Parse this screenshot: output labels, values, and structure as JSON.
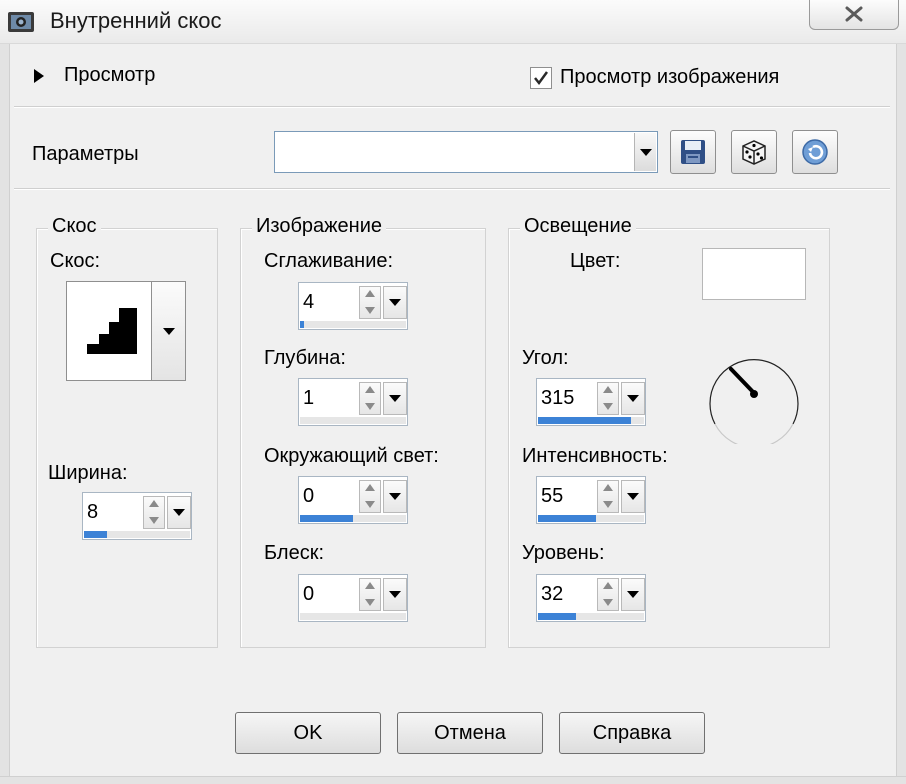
{
  "window": {
    "title": "Внутренний скос"
  },
  "preview": {
    "label": "Просмотр",
    "image_preview_label": "Просмотр изображения",
    "image_preview_checked": true
  },
  "params": {
    "label": "Параметры",
    "value": ""
  },
  "bevel_group": {
    "title": "Скос",
    "bevel_label": "Скос:",
    "width_label": "Ширина:",
    "width_value": "8",
    "width_level": 0.22
  },
  "image_group": {
    "title": "Изображение",
    "smoothing_label": "Сглаживание:",
    "smoothing_value": "4",
    "smoothing_level": 0.04,
    "depth_label": "Глубина:",
    "depth_value": "1",
    "depth_level": 0.0,
    "ambience_label": "Окружающий свет:",
    "ambience_value": "0",
    "ambience_level": 0.5,
    "shininess_label": "Блеск:",
    "shininess_value": "0",
    "shininess_level": 0.0
  },
  "lighting_group": {
    "title": "Освещение",
    "color_label": "Цвет:",
    "color_value": "#ffffff",
    "angle_label": "Угол:",
    "angle_value": "315",
    "angle_level": 0.88,
    "intensity_label": "Интенсивность:",
    "intensity_value": "55",
    "intensity_level": 0.55,
    "elevation_label": "Уровень:",
    "elevation_value": "32",
    "elevation_level": 0.36
  },
  "buttons": {
    "ok": "OK",
    "cancel": "Отмена",
    "help": "Справка"
  },
  "icons": {
    "app": "app-icon",
    "close": "close-icon",
    "save": "save-icon",
    "random": "dice-icon",
    "reset": "reset-icon"
  },
  "colors": {
    "accent": "#3c82d6",
    "background": "#f0f0f0"
  }
}
